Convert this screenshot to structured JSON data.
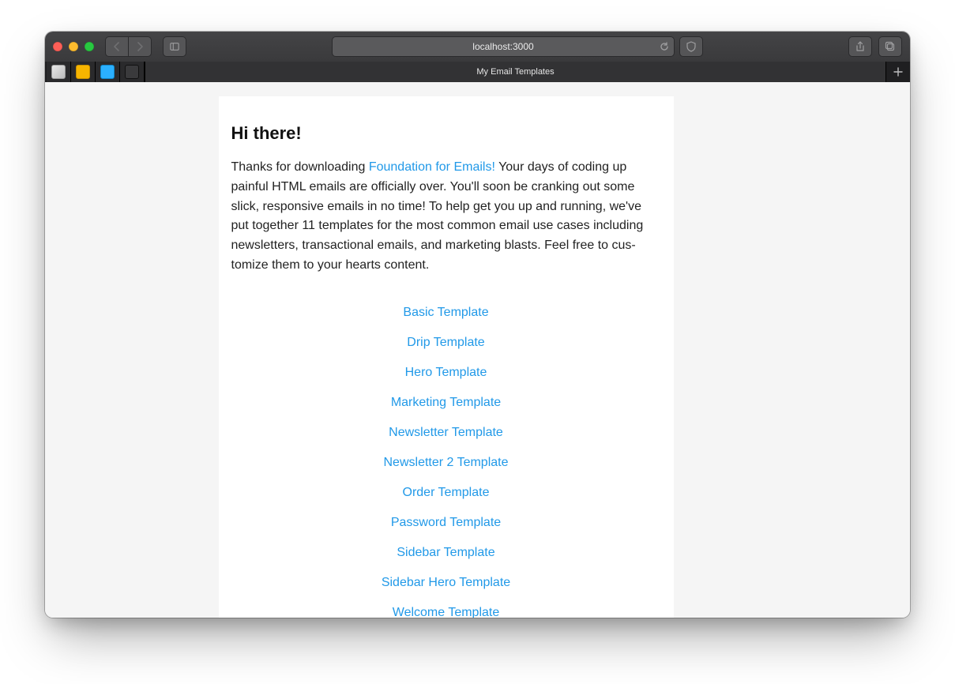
{
  "window": {
    "address": "localhost:3000",
    "tab_title": "My Email Templates"
  },
  "page": {
    "heading": "Hi there!",
    "intro_before_link": "Thanks for downloading ",
    "intro_link_text": "Foundation for Emails!",
    "intro_after_link": " Your days of coding up painful HTML emails are officially over. You'll soon be cranking out some slick, responsive emails in no time! To help get you up and running, we've put together 11 templates for the most common email use cases including newsletters, transactional emails, and marketing blasts. Feel free to cus­tomize them to your hearts content."
  },
  "templates": [
    "Basic Template",
    "Drip Template",
    "Hero Template",
    "Marketing Template",
    "Newsletter Template",
    "Newsletter 2 Template",
    "Order Template",
    "Password Template",
    "Sidebar Template",
    "Sidebar Hero Template",
    "Welcome Template"
  ]
}
